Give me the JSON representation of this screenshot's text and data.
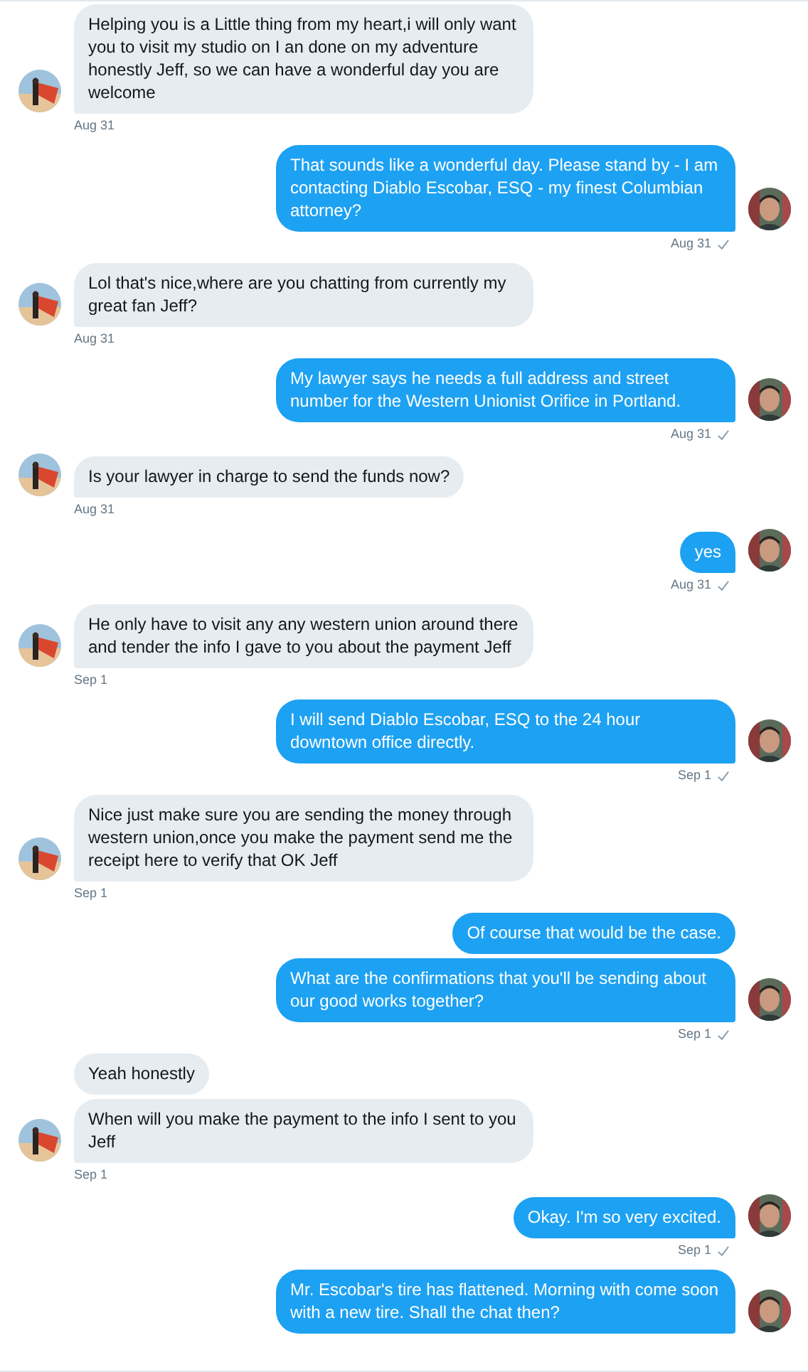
{
  "conversation": [
    {
      "kind": "received",
      "messages": [
        "Helping you is a Little thing  from my heart,i will only want you to visit my studio on I an done on my adventure honestly Jeff, so we can have a wonderful day you are welcome"
      ],
      "time": "Aug 31"
    },
    {
      "kind": "sent",
      "messages": [
        "That sounds like a wonderful day. Please stand by - I am contacting Diablo Escobar, ESQ - my finest Columbian attorney?"
      ],
      "time": "Aug 31",
      "read": true
    },
    {
      "kind": "received",
      "messages": [
        "Lol that's nice,where are you chatting from currently my great fan Jeff?"
      ],
      "time": "Aug 31"
    },
    {
      "kind": "sent",
      "messages": [
        "My lawyer says he needs a full address and street number for the Western Unionist Orifice in Portland."
      ],
      "time": "Aug 31",
      "read": true
    },
    {
      "kind": "received",
      "messages": [
        "Is your lawyer in charge to send the funds now?"
      ],
      "time": "Aug 31"
    },
    {
      "kind": "sent",
      "messages": [
        "yes"
      ],
      "time": "Aug 31",
      "read": true
    },
    {
      "kind": "received",
      "messages": [
        "He only have to visit any any western union around there and tender the info I gave to you about the payment Jeff"
      ],
      "time": "Sep 1"
    },
    {
      "kind": "sent",
      "messages": [
        "I will send Diablo Escobar, ESQ to the 24 hour downtown office directly."
      ],
      "time": "Sep 1",
      "read": true
    },
    {
      "kind": "received",
      "messages": [
        "Nice just make sure you are sending the money through western union,once you make the payment send me the receipt here to verify that OK Jeff"
      ],
      "time": "Sep 1"
    },
    {
      "kind": "sent",
      "messages": [
        "Of course that would be the case.",
        "What are the confirmations that you'll be sending about our good works together?"
      ],
      "time": "Sep 1",
      "read": true
    },
    {
      "kind": "received",
      "messages": [
        "Yeah honestly",
        "When will you make the payment to the info I sent to you Jeff"
      ],
      "time": "Sep 1"
    },
    {
      "kind": "sent",
      "messages": [
        "Okay. I'm so very excited."
      ],
      "time": "Sep 1",
      "read": true
    },
    {
      "kind": "sent",
      "messages": [
        "Mr. Escobar's tire has flattened. Morning with come soon with a new tire. Shall the chat then?"
      ]
    }
  ]
}
